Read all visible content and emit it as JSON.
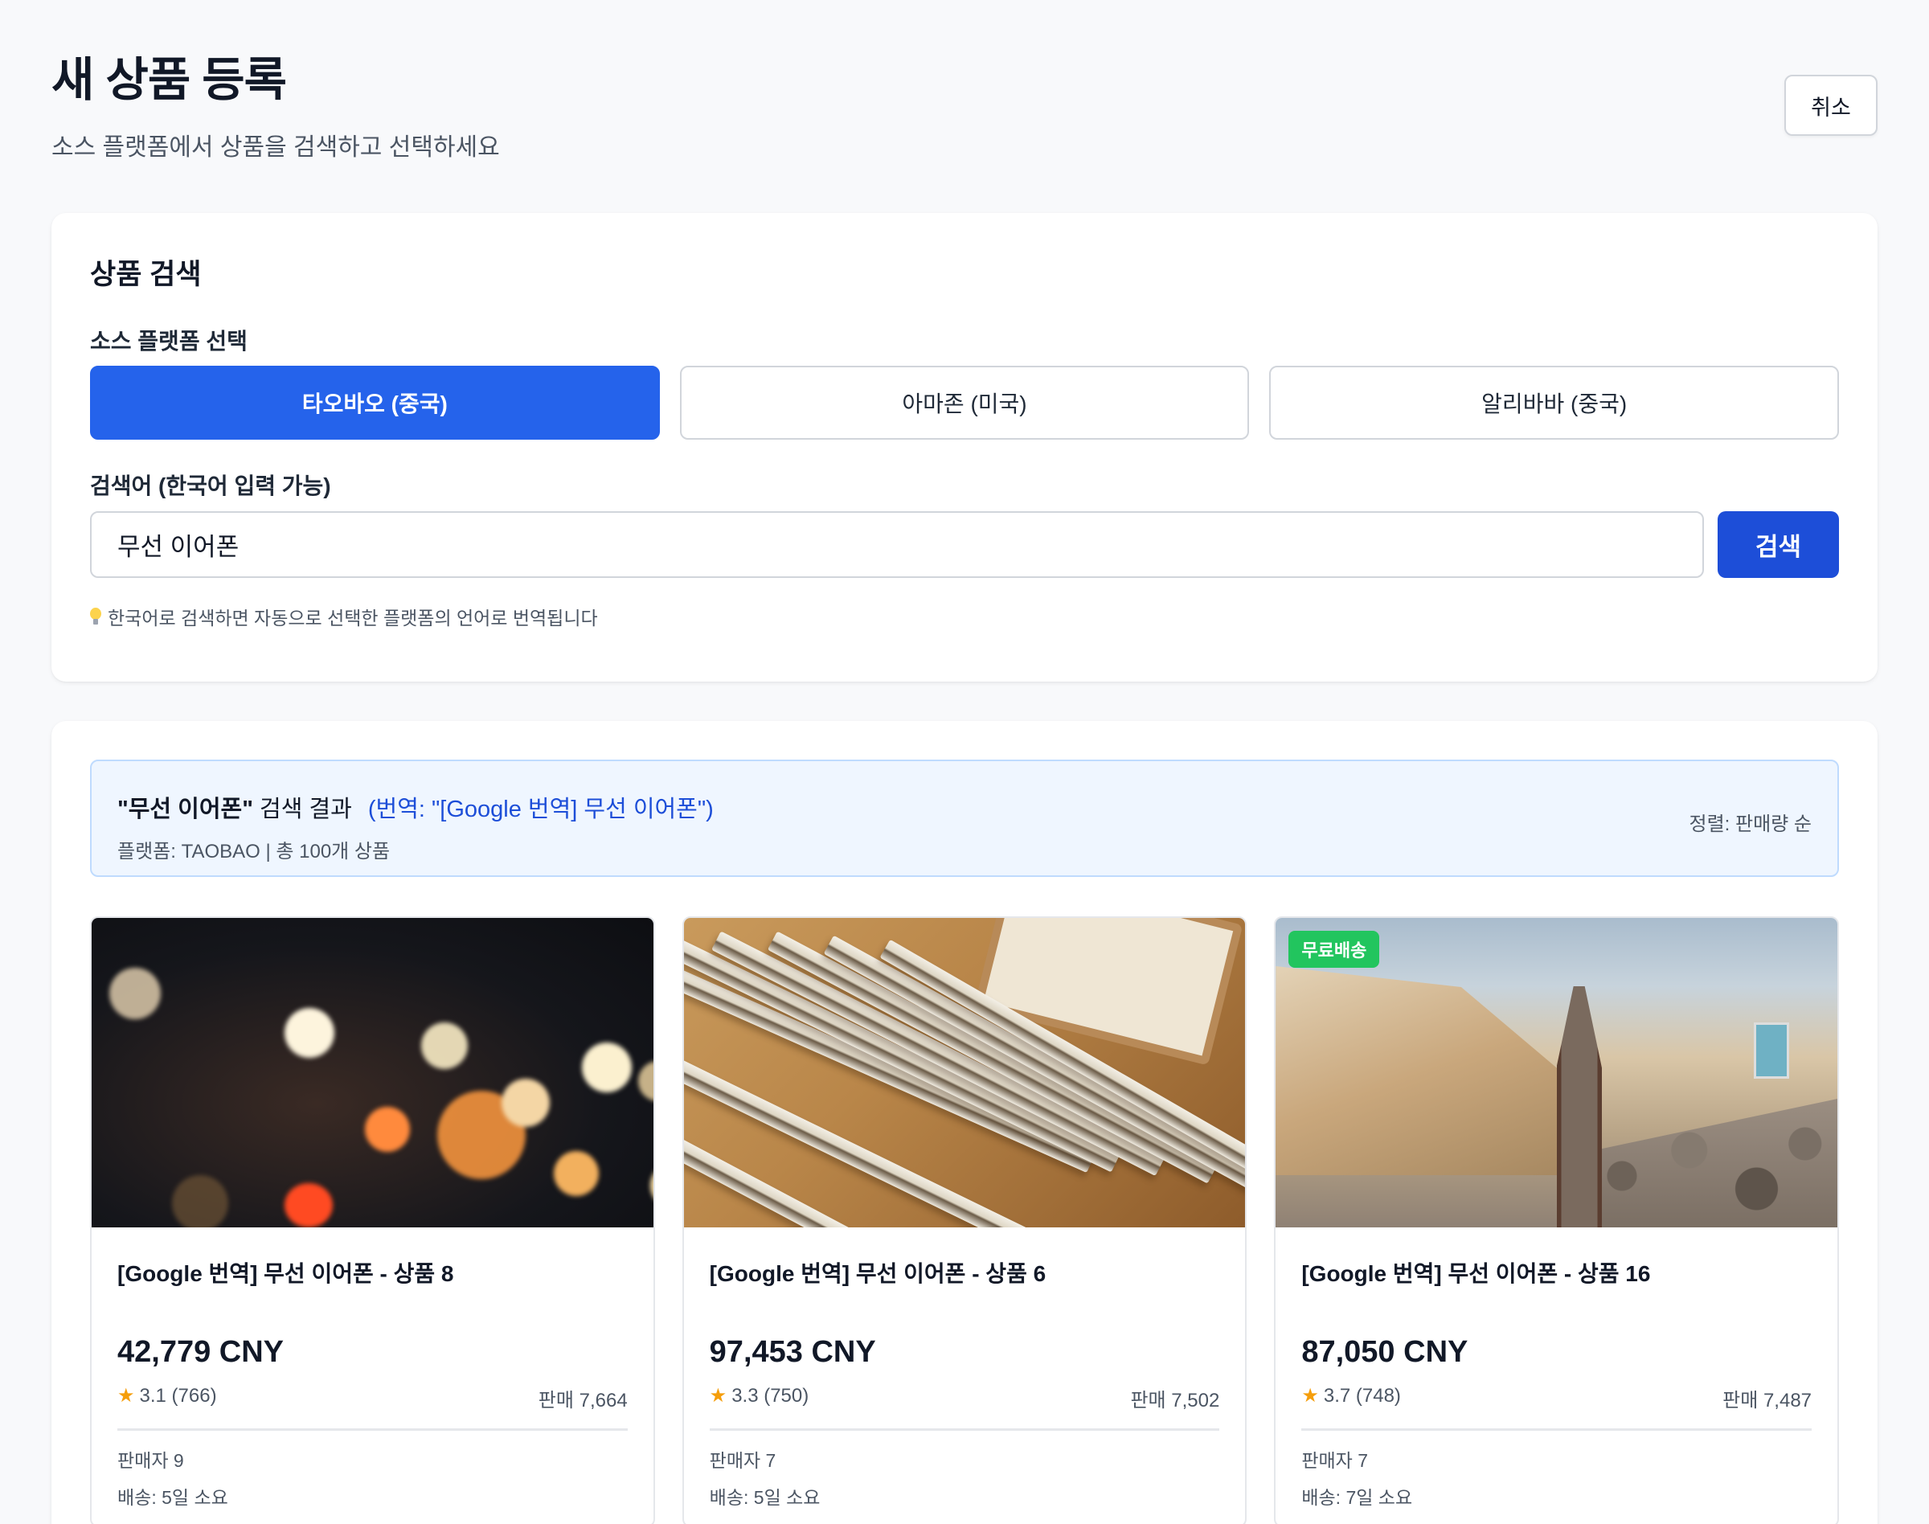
{
  "header": {
    "title": "새 상품 등록",
    "subtitle": "소스 플랫폼에서 상품을 검색하고 선택하세요",
    "cancel_label": "취소"
  },
  "search": {
    "section_title": "상품 검색",
    "platform_label": "소스 플랫폼 선택",
    "platforms": [
      {
        "label": "타오바오 (중국)",
        "selected": true
      },
      {
        "label": "아마존 (미국)",
        "selected": false
      },
      {
        "label": "알리바바 (중국)",
        "selected": false
      }
    ],
    "query_label": "검색어 (한국어 입력 가능)",
    "query_value": "무선 이어폰",
    "search_button": "검색",
    "hint_icon": "lightbulb-icon",
    "hint": "한국어로 검색하면 자동으로 선택한 플랫폼의 언어로 번역됩니다"
  },
  "results": {
    "query_text": "\"무선 이어폰\"",
    "result_word": " 검색 결과",
    "translated_text": "(번역: \"[Google 번역] 무선 이어폰\")",
    "meta": "플랫폼: TAOBAO | 총 100개 상품",
    "sort": "정렬: 판매량 순",
    "products": [
      {
        "title": "[Google 번역] 무선 이어폰 - 상품 8",
        "price": "42,779 CNY",
        "rating": "3.1 (766)",
        "sales": "판매 7,664",
        "seller": "판매자 9",
        "shipping": "배송: 5일 소요",
        "badge": ""
      },
      {
        "title": "[Google 번역] 무선 이어폰 - 상품 6",
        "price": "97,453 CNY",
        "rating": "3.3 (750)",
        "sales": "판매 7,502",
        "seller": "판매자 7",
        "shipping": "배송: 5일 소요",
        "badge": ""
      },
      {
        "title": "[Google 번역] 무선 이어폰 - 상품 16",
        "price": "87,050 CNY",
        "rating": "3.7 (748)",
        "sales": "판매 7,487",
        "seller": "판매자 7",
        "shipping": "배송: 7일 소요",
        "badge": "무료배송"
      }
    ]
  },
  "colors": {
    "primary": "#2563eb",
    "primary_dark": "#1d4ed8",
    "free_shipping_badge": "#22c55e",
    "star": "#f59e0b",
    "banner_bg": "#eff6ff"
  }
}
